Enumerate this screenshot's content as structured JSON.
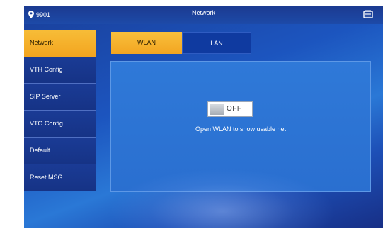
{
  "status": {
    "location_code": "9901"
  },
  "header": {
    "title": "Network"
  },
  "sidebar": {
    "items": [
      {
        "label": "Network"
      },
      {
        "label": "VTH Config"
      },
      {
        "label": "SIP Server"
      },
      {
        "label": "VTO Config"
      },
      {
        "label": "Default"
      },
      {
        "label": "Reset MSG"
      }
    ]
  },
  "tabs": [
    {
      "label": "WLAN"
    },
    {
      "label": "LAN"
    }
  ],
  "wlan": {
    "toggle_state": "OFF",
    "hint": "Open WLAN to show usable net"
  },
  "colors": {
    "accent": "#f4a825",
    "panel": "#2c74d4",
    "sidebar": "#183690"
  },
  "icons": {
    "location": "location-pin-icon",
    "messages": "messages-icon"
  }
}
